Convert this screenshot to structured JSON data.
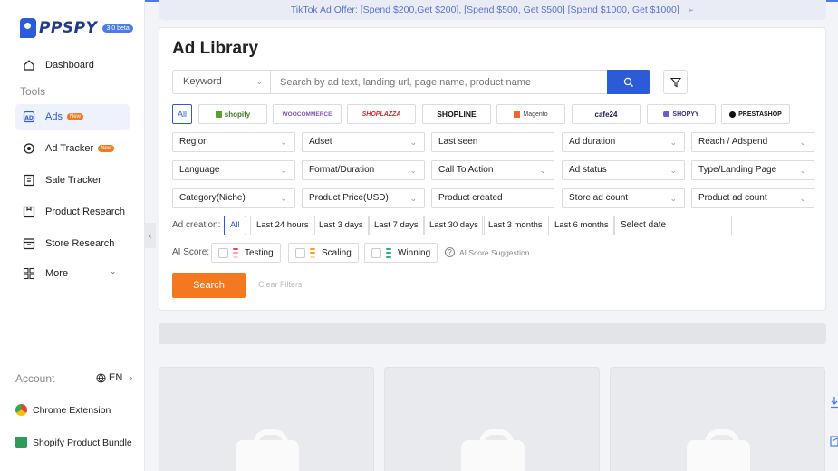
{
  "app": {
    "name": "PPSPY",
    "version_badge": "3.0 beta"
  },
  "sidebar": {
    "items": [
      {
        "label": "Dashboard",
        "icon": "home-icon"
      },
      {
        "label": "Ads",
        "icon": "ad-icon",
        "badge": "New",
        "active": true
      },
      {
        "label": "Ad Tracker",
        "icon": "target-icon",
        "badge": "New"
      },
      {
        "label": "Sale Tracker",
        "icon": "sale-icon"
      },
      {
        "label": "Product Research",
        "icon": "product-icon"
      },
      {
        "label": "Store Research",
        "icon": "store-icon"
      },
      {
        "label": "More",
        "icon": "grid-icon"
      }
    ],
    "tools_label": "Tools",
    "account_label": "Account",
    "language": "EN",
    "extensions": [
      {
        "label": "Chrome Extension",
        "icon": "chrome-icon"
      },
      {
        "label": "Shopify Product Bundle",
        "icon": "shopify-bag-icon"
      }
    ]
  },
  "banner": {
    "text": "TikTok Ad Offer: [Spend $200,Get $200], [Spend $500, Get $500] [Spend $1000, Get $1000]"
  },
  "main": {
    "title": "Ad Library",
    "search": {
      "scope": "Keyword",
      "placeholder": "Search by ad text, landing url, page name, product name"
    },
    "platforms": [
      "All",
      "shopify",
      "WOOCOMMERCE",
      "SHOPLAZZA",
      "SHOPLINE",
      "Magento",
      "cafe24",
      "SHOPYY",
      "PRESTASHOP"
    ],
    "filters": [
      [
        "Region",
        "Adset",
        "Last seen",
        "Ad duration",
        "Reach / Adspend"
      ],
      [
        "Language",
        "Format/Duration",
        "Call To Action",
        "Ad status",
        "Type/Landing Page"
      ],
      [
        "Category(Niche)",
        "Product Price(USD)",
        "Product created",
        "Store ad count",
        "Product ad count"
      ]
    ],
    "ad_creation": {
      "label": "Ad creation:",
      "options": [
        "All",
        "Last 24 hours",
        "Last 3 days",
        "Last 7 days",
        "Last 30 days",
        "Last 3 months",
        "Last 6 months"
      ],
      "date_placeholder": "Select date"
    },
    "ai_score": {
      "label": "AI Score:",
      "options": [
        {
          "label": "Testing",
          "color": "#e8474c"
        },
        {
          "label": "Scaling",
          "color": "#f4a11f"
        },
        {
          "label": "Winning",
          "color": "#26b07a"
        }
      ],
      "suggestion": "AI Score Suggestion"
    },
    "search_button": "Search",
    "clear_label": "Clear Filters"
  },
  "colors": {
    "accent": "#2c5bd8",
    "cta": "#f4781f"
  }
}
